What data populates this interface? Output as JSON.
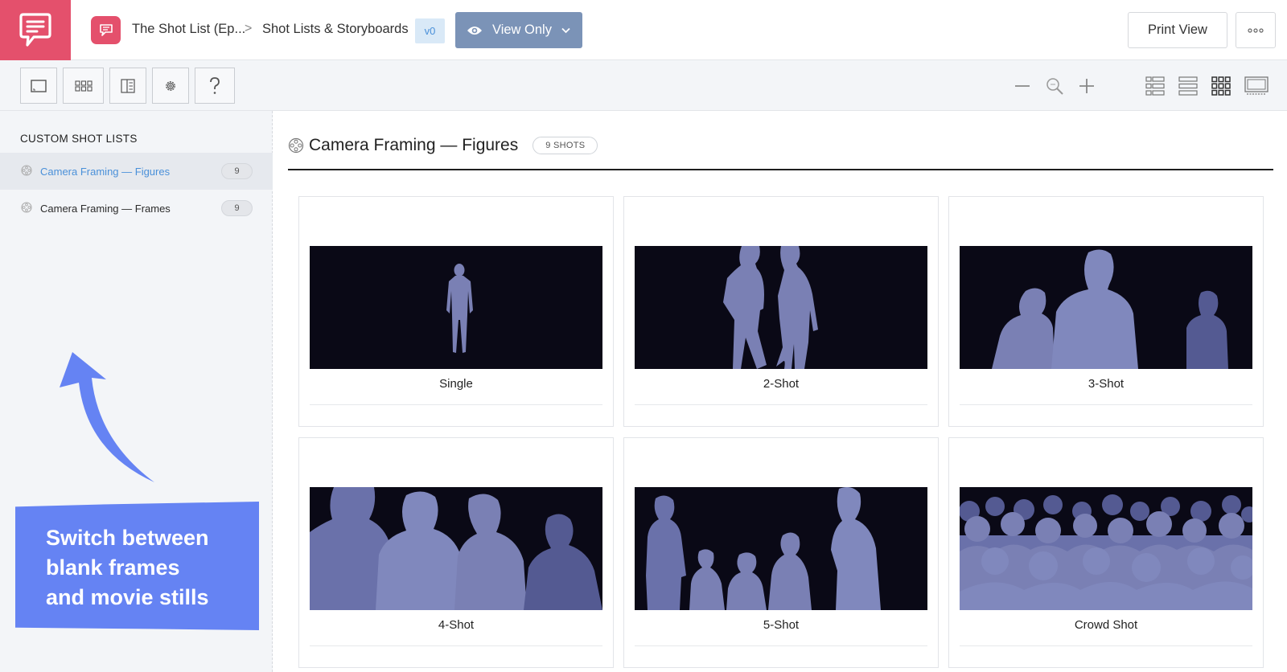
{
  "header": {
    "project_name": "The Shot List (Ep...",
    "section_name": "Shot Lists & Storyboards",
    "breadcrumb_separator": ">",
    "version": "v0",
    "view_mode": "View Only",
    "print_label": "Print View"
  },
  "sidebar": {
    "heading": "CUSTOM SHOT LISTS",
    "items": [
      {
        "label": "Camera Framing — Figures",
        "count": "9",
        "active": true
      },
      {
        "label": "Camera Framing — Frames",
        "count": "9",
        "active": false
      }
    ],
    "callout": [
      "Switch between",
      "blank frames",
      "and movie stills"
    ]
  },
  "main": {
    "title": "Camera Framing — Figures",
    "shot_count": "9 SHOTS",
    "shots": [
      {
        "caption": "Single"
      },
      {
        "caption": "2-Shot"
      },
      {
        "caption": "3-Shot"
      },
      {
        "caption": "4-Shot"
      },
      {
        "caption": "5-Shot"
      },
      {
        "caption": "Crowd Shot"
      }
    ]
  },
  "colors": {
    "brand": "#e4506c",
    "accent_blue": "#4a90d9",
    "view_button": "#7b93b7",
    "callout": "#6583f3",
    "frame_bg": "#0a0916",
    "silhouette_light": "#7a80b4",
    "silhouette_dark": "#545a92"
  },
  "icons": {
    "toolbar": [
      "frame-icon",
      "grid-icon",
      "split-icon",
      "gear-icon",
      "help-icon"
    ],
    "zoom": [
      "zoom-out-icon",
      "zoom-reset-icon",
      "zoom-in-icon"
    ],
    "views": [
      "list-detail-icon",
      "list-rows-icon",
      "grid-view-icon",
      "presentation-icon"
    ]
  }
}
